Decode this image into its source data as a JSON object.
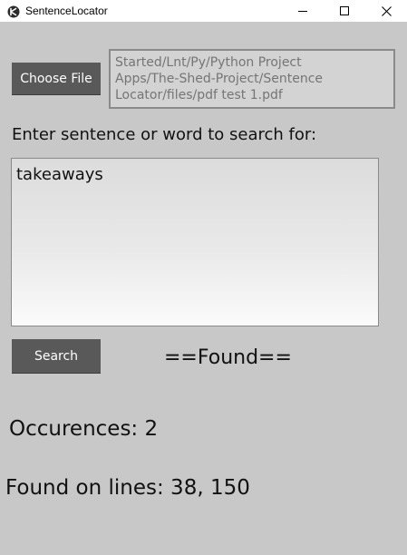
{
  "window": {
    "title": "SentenceLocator",
    "icon": "kivy-app-icon"
  },
  "file": {
    "choose_label": "Choose File",
    "path_lines": [
      "Started/Lnt/Py/Python Project",
      "Apps/The-Shed-Project/Sentence",
      "Locator/files/pdf test 1.pdf"
    ]
  },
  "search": {
    "prompt": "Enter sentence or word to search for:",
    "query": "takeaways",
    "button_label": "Search"
  },
  "results": {
    "status": "==Found==",
    "occurrences": "Occurences: 2",
    "lines": "Found on lines: 38, 150"
  },
  "colors": {
    "background": "#c8c8c8",
    "button": "#595959",
    "button_text": "#ffffff",
    "path_text": "#757575"
  }
}
